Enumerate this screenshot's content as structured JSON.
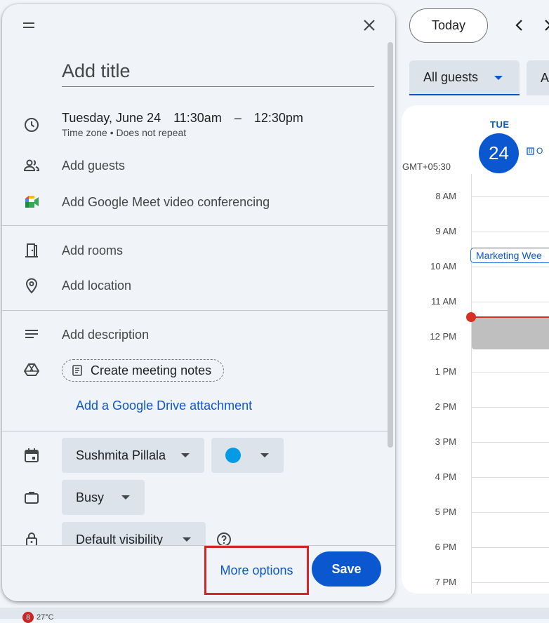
{
  "colors": {
    "accent": "#0b57d0",
    "now_line": "#d93025",
    "highlight_box": "#d9232b",
    "event_color": "#039be5"
  },
  "calendar": {
    "today_label": "Today",
    "guests_filter": "All guests",
    "second_filter": "A",
    "day_name": "TUE",
    "day_number": "24",
    "chip_text": "O",
    "timezone": "GMT+05:30",
    "hours": [
      "8 AM",
      "9 AM",
      "10 AM",
      "11 AM",
      "12 PM",
      "1 PM",
      "2 PM",
      "3 PM",
      "4 PM",
      "5 PM",
      "6 PM",
      "7 PM"
    ],
    "event_title": "Marketing Wee",
    "weather": {
      "badge": "8",
      "temp": "27°C"
    }
  },
  "dialog": {
    "title_placeholder": "Add title",
    "date": "Tuesday, June 24",
    "start_time": "11:30am",
    "dash": "–",
    "end_time": "12:30pm",
    "timezone_repeat": "Time zone • Does not repeat",
    "add_guests": "Add guests",
    "meet": "Add Google Meet video conferencing",
    "add_rooms": "Add rooms",
    "add_location": "Add location",
    "add_description": "Add description",
    "meeting_notes": "Create meeting notes",
    "drive_attachment": "Add a Google Drive attachment",
    "calendar_owner": "Sushmita Pillala",
    "availability": "Busy",
    "visibility": "Default visibility",
    "more_options": "More options",
    "save": "Save"
  },
  "icons": [
    "drag-handle-icon",
    "close-icon",
    "clock-icon",
    "people-icon",
    "google-meet-icon",
    "door-icon",
    "location-pin-icon",
    "description-lines-icon",
    "drive-icon",
    "notes-doc-icon",
    "calendar-icon",
    "briefcase-icon",
    "lock-icon",
    "help-icon",
    "chevron-left-icon",
    "chevron-right-icon",
    "caret-down-icon"
  ]
}
